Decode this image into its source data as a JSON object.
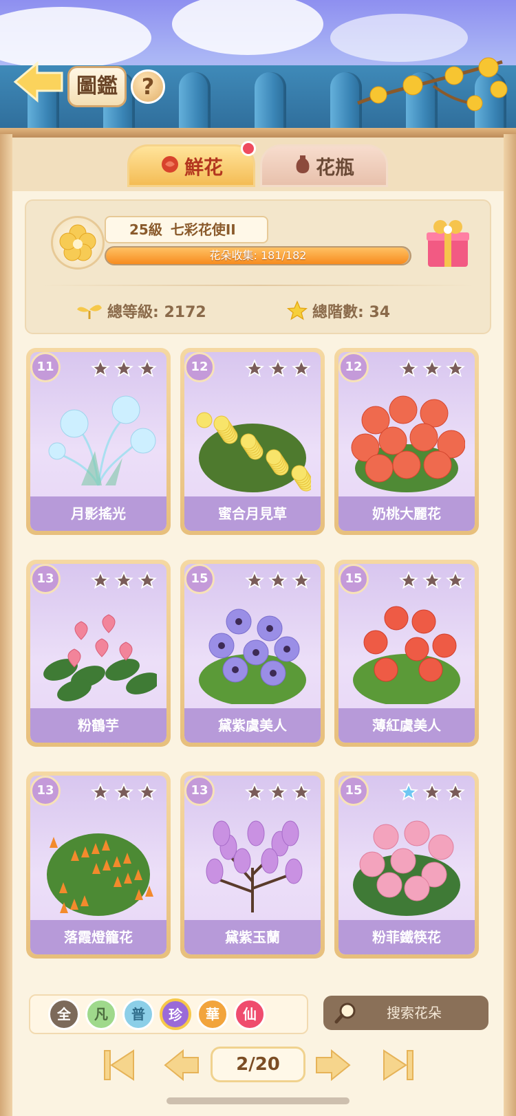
{
  "header": {
    "title": "圖鑑",
    "help_label": "?"
  },
  "tabs": [
    {
      "label": "鮮花",
      "active": true,
      "has_notification": true
    },
    {
      "label": "花瓶",
      "active": false
    }
  ],
  "summary": {
    "level": "25級",
    "rank_title": "七彩花使II",
    "collection_text": "花朵收集: 181/182",
    "collection_progress": 0.9945,
    "total_level_label": "總等級: 2172",
    "total_stars_label": "總階數: 34"
  },
  "cards": [
    {
      "level": "11",
      "name": "月影搖光",
      "stars": [
        0,
        0,
        0
      ],
      "art": "moonlight-flower"
    },
    {
      "level": "12",
      "name": "蜜合月見草",
      "stars": [
        0,
        0,
        0
      ],
      "art": "yellow-primrose"
    },
    {
      "level": "12",
      "name": "奶桃大麗花",
      "stars": [
        0,
        0,
        0
      ],
      "art": "dahlia"
    },
    {
      "level": "13",
      "name": "粉鶴芋",
      "stars": [
        0,
        0,
        0
      ],
      "art": "anthurium"
    },
    {
      "level": "15",
      "name": "黛紫虞美人",
      "stars": [
        0,
        0,
        0
      ],
      "art": "purple-poppy"
    },
    {
      "level": "15",
      "name": "薄紅虞美人",
      "stars": [
        0,
        0,
        0
      ],
      "art": "red-poppy"
    },
    {
      "level": "13",
      "name": "落霞燈籠花",
      "stars": [
        0,
        0,
        0
      ],
      "art": "fuchsia"
    },
    {
      "level": "13",
      "name": "黛紫玉蘭",
      "stars": [
        0,
        0,
        0
      ],
      "art": "magnolia"
    },
    {
      "level": "15",
      "name": "粉菲鐵筷花",
      "stars": [
        1,
        0,
        0
      ],
      "art": "hellebore"
    }
  ],
  "rarity_filters": [
    {
      "label": "全",
      "color": "#7c6a5a",
      "selected": false
    },
    {
      "label": "凡",
      "color": "#9fd98c",
      "selected": false
    },
    {
      "label": "普",
      "color": "#8ccfe8",
      "selected": false
    },
    {
      "label": "珍",
      "color": "#9a6ad8",
      "selected": true
    },
    {
      "label": "華",
      "color": "#f2a43c",
      "selected": false
    },
    {
      "label": "仙",
      "color": "#ef4c6e",
      "selected": false
    }
  ],
  "search": {
    "placeholder": "搜索花朵"
  },
  "pager": {
    "page_text": "2/20"
  },
  "colors": {
    "star_filled": "#6ec7f2",
    "star_empty": "#7a5c59",
    "accent": "#f4bc55"
  }
}
